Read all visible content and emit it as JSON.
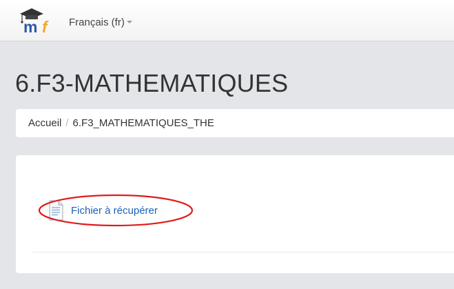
{
  "navbar": {
    "logo_alt": "moodle logo",
    "language_label": "Français (fr)",
    "caret_icon": "caret-down-icon"
  },
  "page": {
    "title": "6.F3-MATHEMATIQUES"
  },
  "breadcrumb": {
    "items": [
      {
        "label": "Accueil"
      },
      {
        "label": "6.F3_MATHEMATIQUES_THE"
      }
    ],
    "separator": "/"
  },
  "content": {
    "activities": [
      {
        "label": "Fichier à récupérer",
        "icon": "file-icon"
      }
    ],
    "annotation_color": "#e01b1b"
  },
  "colors": {
    "background": "#e4e5e9",
    "link": "#1862b6",
    "text": "#333333"
  }
}
